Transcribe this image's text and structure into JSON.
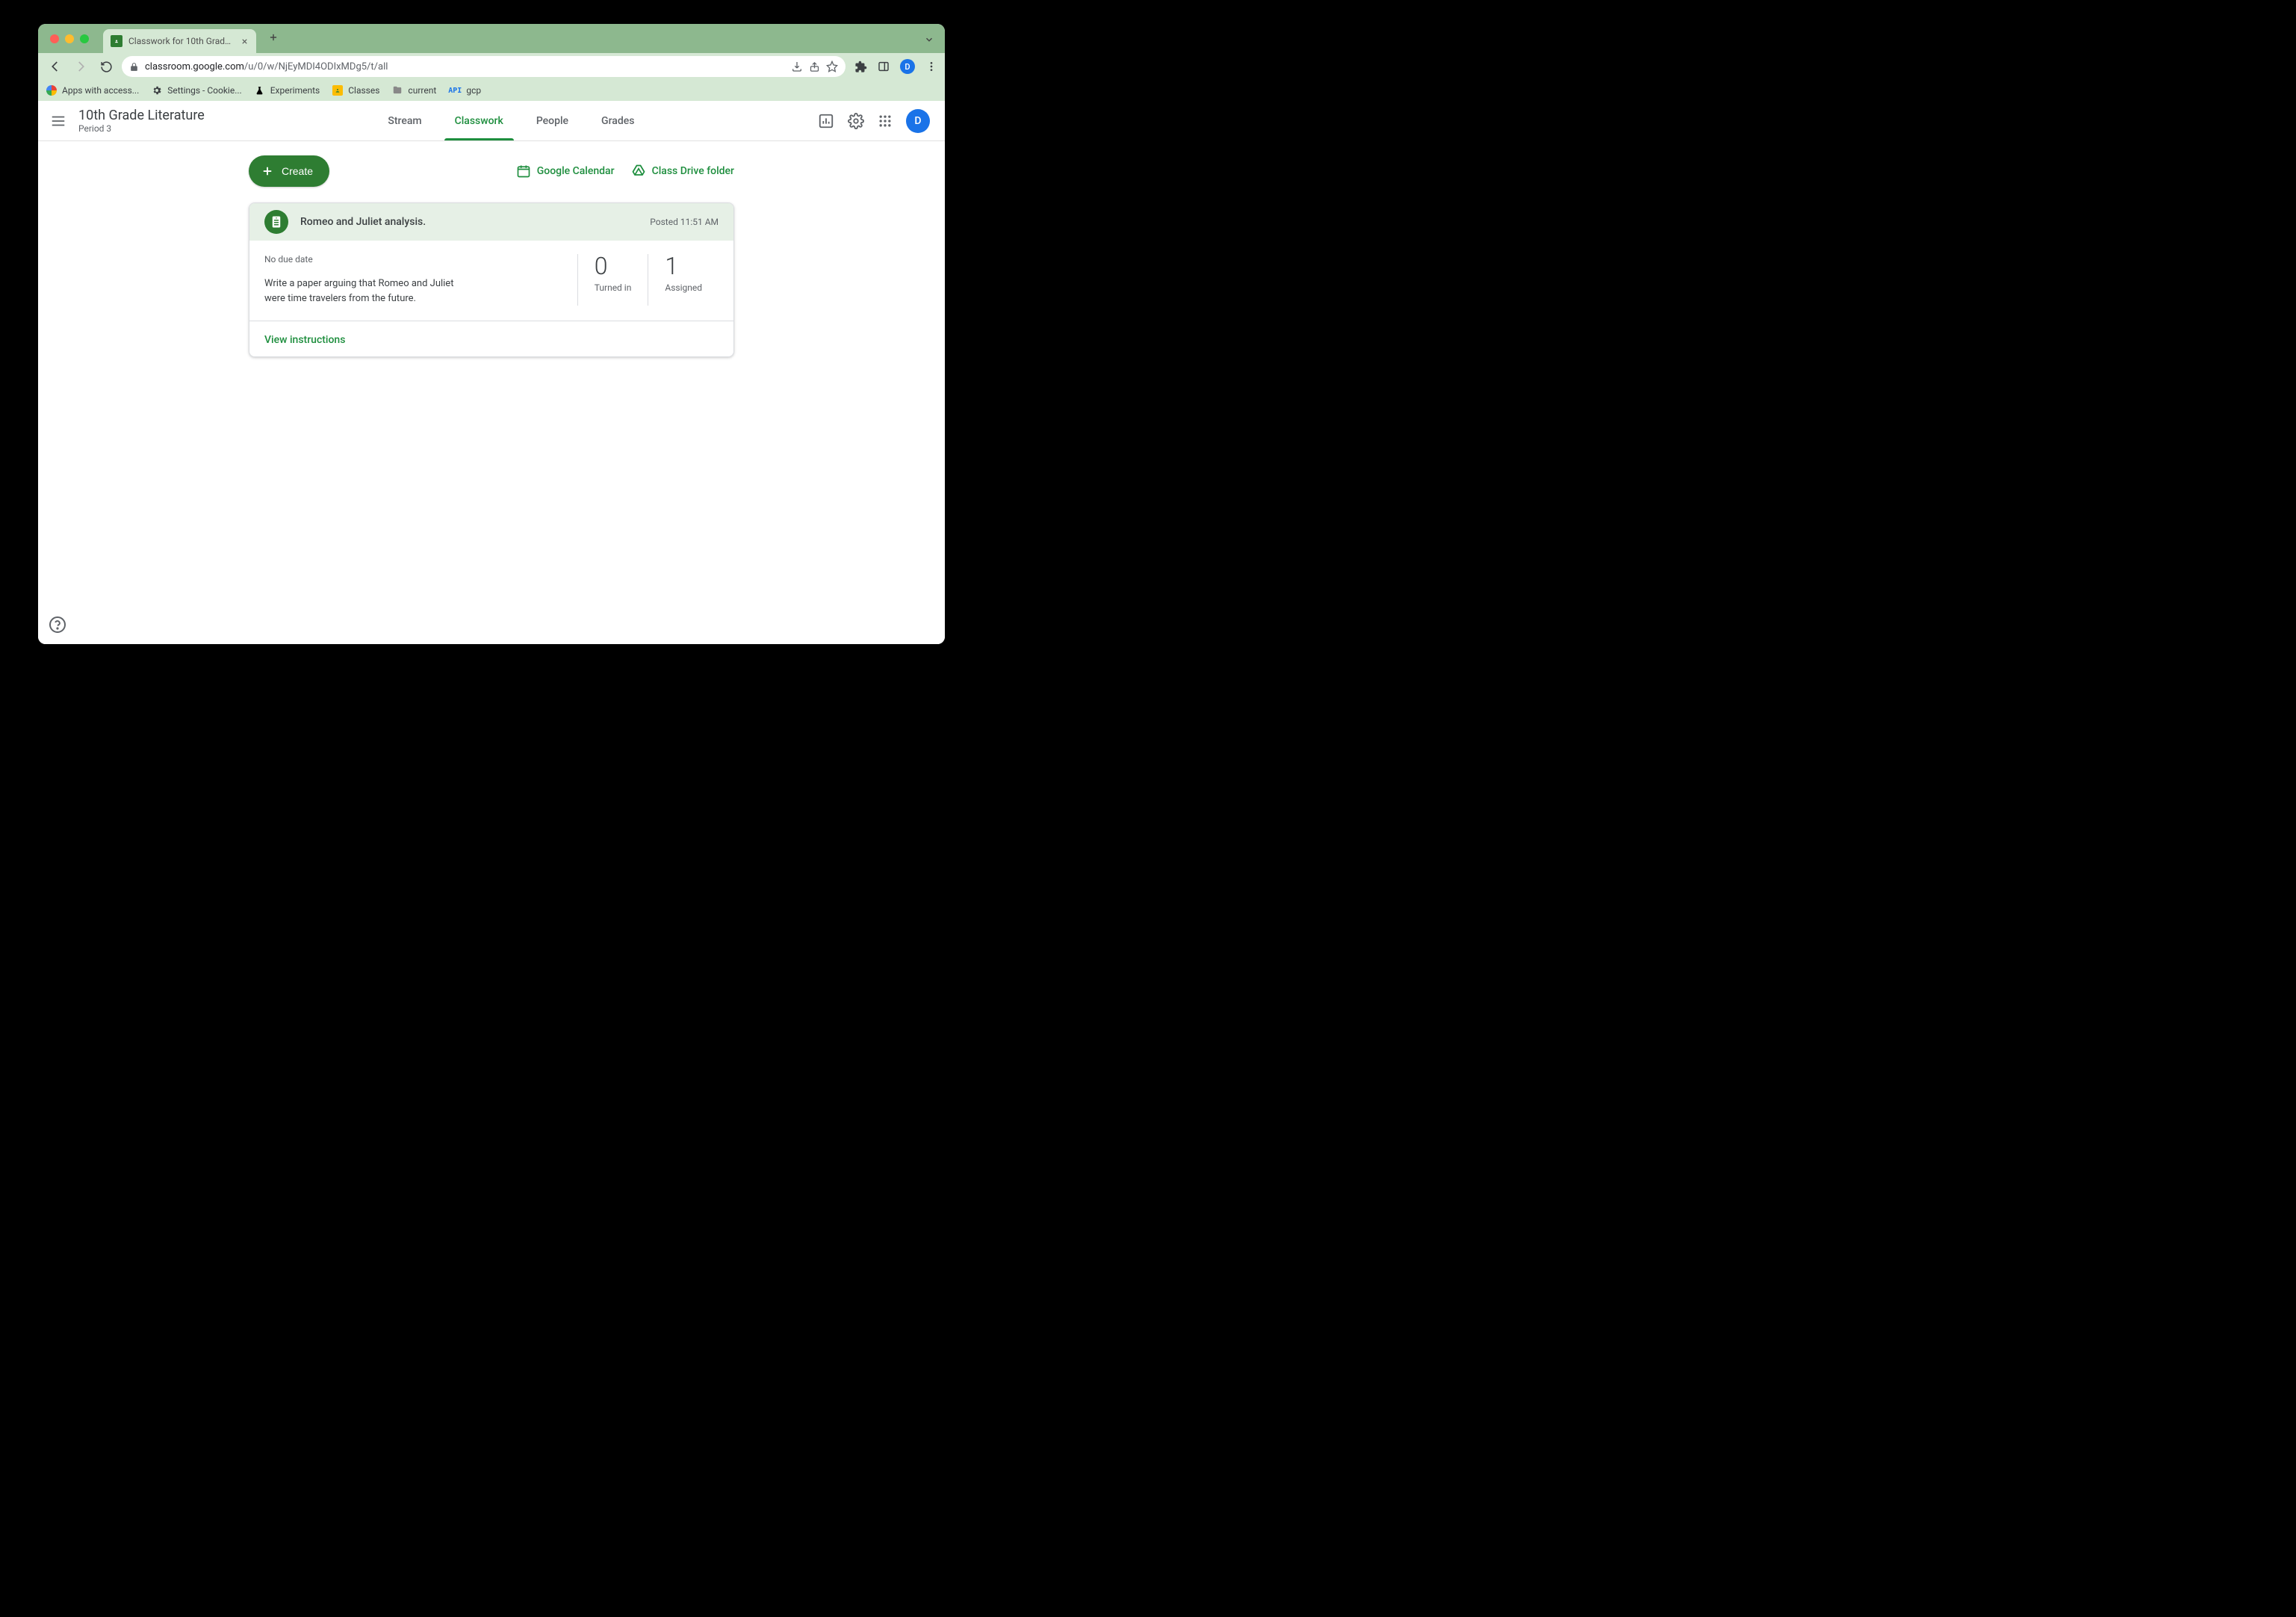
{
  "browser": {
    "tab_title": "Classwork for 10th Grade Liter...",
    "url_display_prefix": "classroom.google.com",
    "url_display_path": "/u/0/w/NjEyMDI4ODIxMDg5/t/all",
    "bookmarks": [
      {
        "label": "Apps with access..."
      },
      {
        "label": "Settings - Cookie..."
      },
      {
        "label": "Experiments"
      },
      {
        "label": "Classes"
      },
      {
        "label": "current"
      },
      {
        "label": "gcp"
      }
    ]
  },
  "header": {
    "class_name": "10th Grade Literature",
    "class_section": "Period 3",
    "tabs": {
      "stream": "Stream",
      "classwork": "Classwork",
      "people": "People",
      "grades": "Grades"
    },
    "avatar_initial": "D"
  },
  "actions": {
    "create": "Create",
    "google_calendar": "Google Calendar",
    "class_drive": "Class Drive folder"
  },
  "assignment": {
    "title": "Romeo and Juliet analysis.",
    "posted": "Posted 11:51 AM",
    "due": "No due date",
    "description": "Write a paper arguing that Romeo and Juliet were time travelers from the future.",
    "turned_in_count": "0",
    "turned_in_label": "Turned in",
    "assigned_count": "1",
    "assigned_label": "Assigned",
    "view_instructions": "View instructions"
  }
}
